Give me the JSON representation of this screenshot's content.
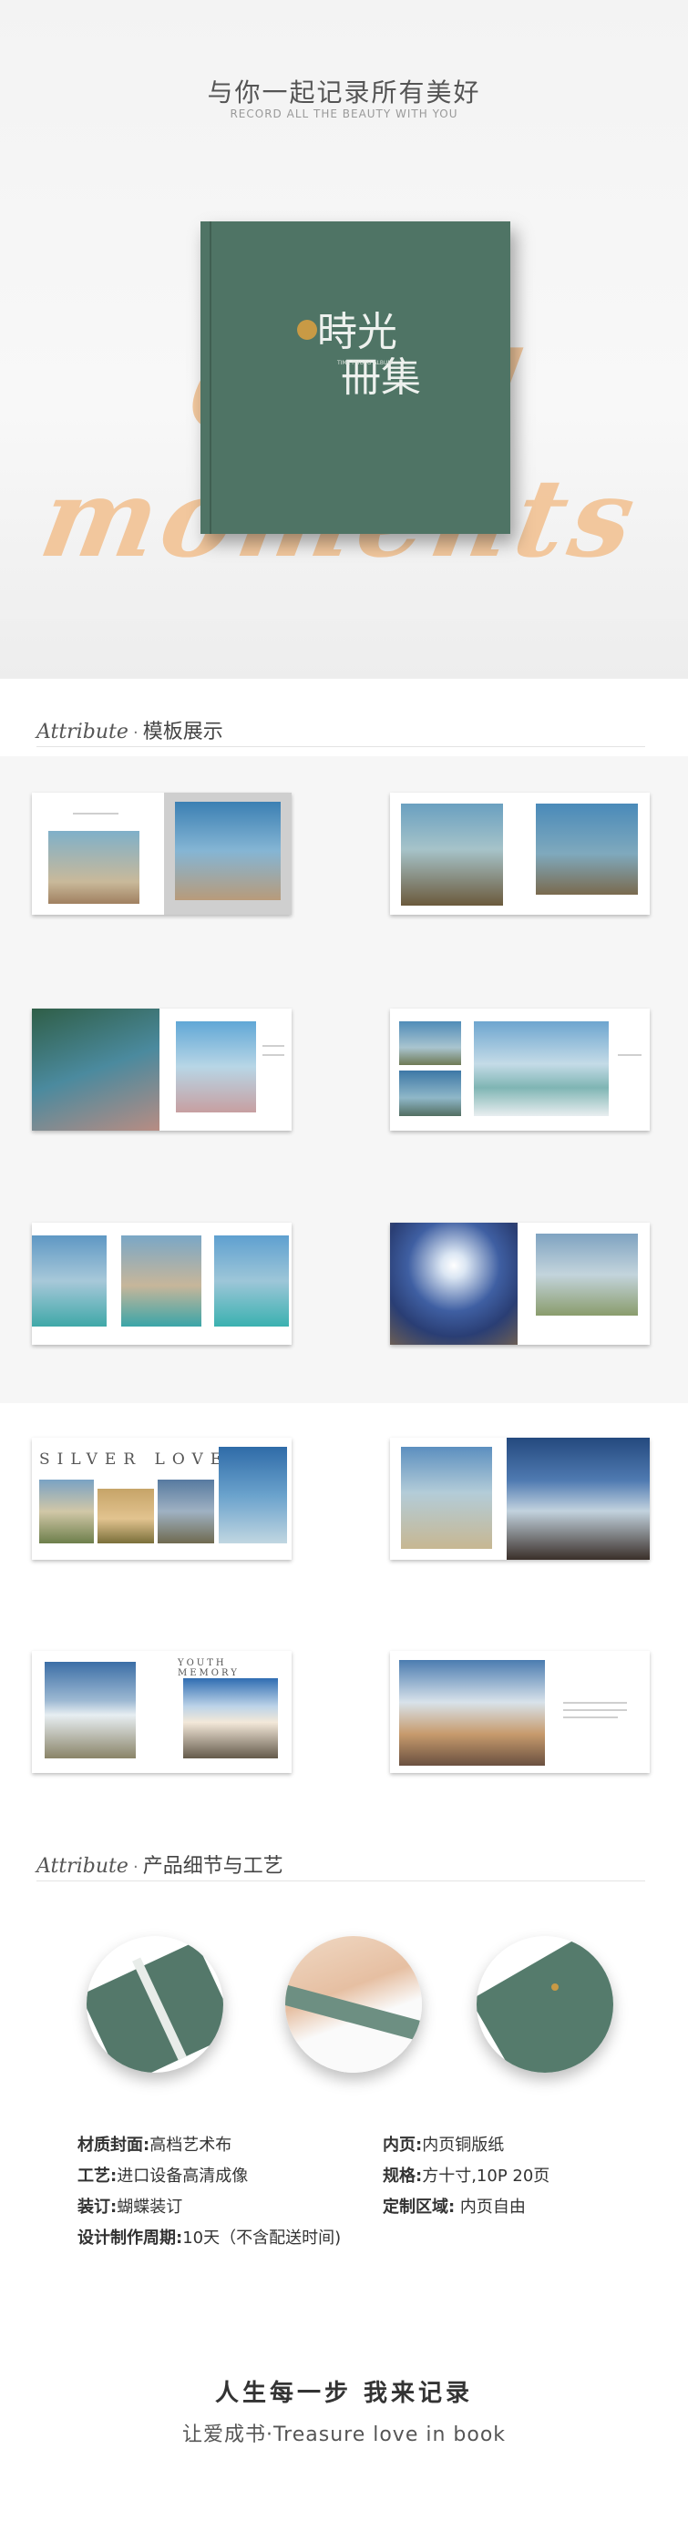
{
  "hero": {
    "title": "与你一起记录所有美好",
    "subtitle": "RECORD ALL THE BEAUTY WITH YOU",
    "script_text": "Good moments",
    "album_logo_line1": "時光",
    "album_logo_line2": "冊集",
    "album_tagline": "TIME PHOTO ALBUM",
    "album_color": "#4f7465",
    "script_color": "#f2c08f"
  },
  "section1": {
    "en": "Attribute",
    "sep": "·",
    "cn": "模板展示"
  },
  "spreads": {
    "silver_love": "SILVER  LOVE",
    "youth_memory": "YOUTH MEMORY"
  },
  "section2": {
    "en": "Attribute",
    "sep": "·",
    "cn": "产品细节与工艺"
  },
  "specs": {
    "material_label": "材质封面:",
    "material_value": "高档艺术布",
    "inner_label": "内页:",
    "inner_value": "内页铜版纸",
    "craft_label": "工艺:",
    "craft_value": "进口设备高清成像",
    "size_label": "规格:",
    "size_value": "方十寸,10P 20页",
    "binding_label": "装订:",
    "binding_value": "蝴蝶装订",
    "custom_label": "定制区域:",
    "custom_value": " 内页自由",
    "period_label": "设计制作周期:",
    "period_value": "10天（不含配送时间)"
  },
  "footer": {
    "line1": "人生每一步 我来记录",
    "line2": "让爱成书·Treasure love in book"
  }
}
